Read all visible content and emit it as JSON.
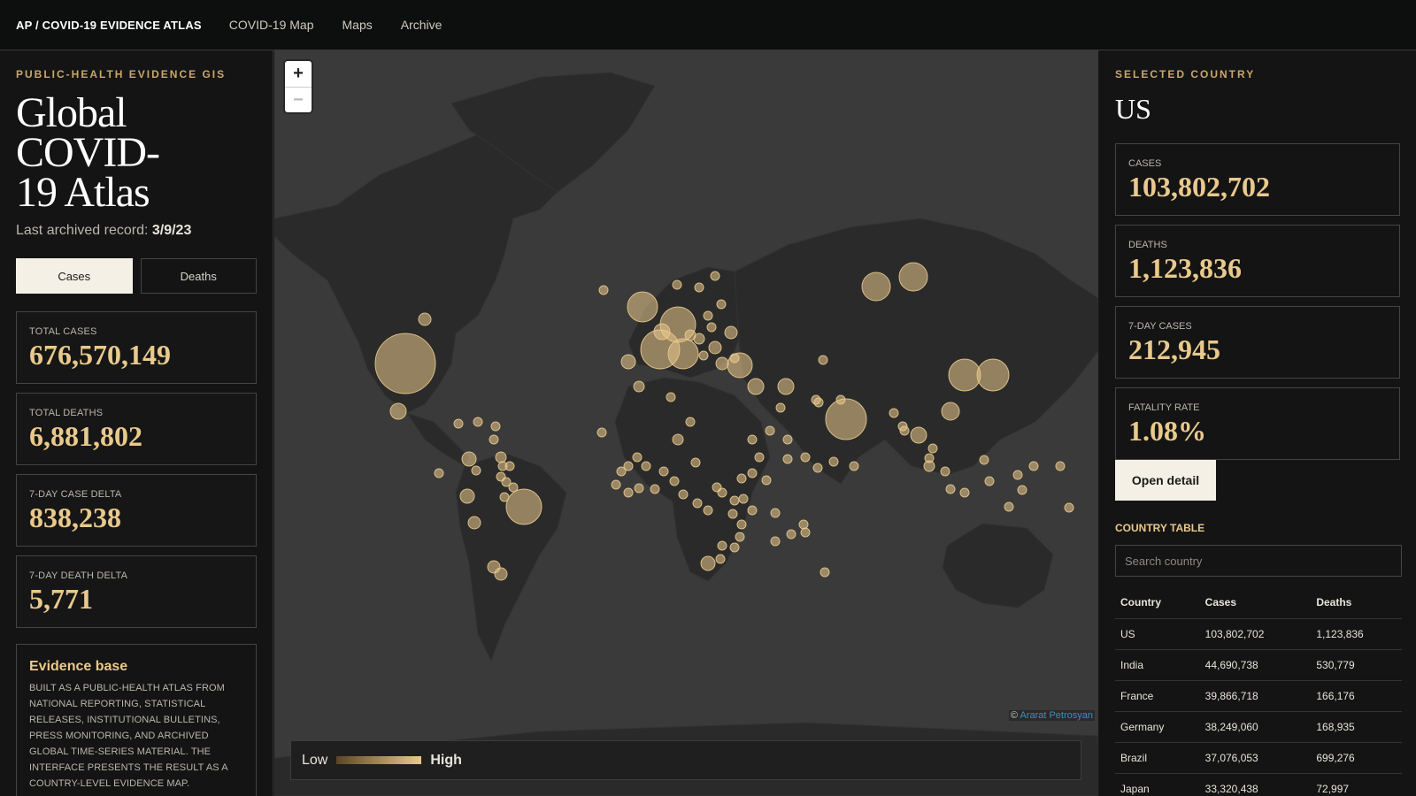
{
  "nav": {
    "brand": "AP / COVID-19 EVIDENCE ATLAS",
    "links": [
      "COVID-19 Map",
      "Maps",
      "Archive"
    ]
  },
  "left": {
    "eyebrow": "PUBLIC-HEALTH EVIDENCE GIS",
    "title": "Global COVID-19 Atlas",
    "subtitle_prefix": "Last archived record:",
    "subtitle_date": "3/9/23",
    "toggle": {
      "cases": "Cases",
      "deaths": "Deaths",
      "selected": "cases"
    },
    "stats": [
      {
        "label": "TOTAL CASES",
        "value": "676,570,149"
      },
      {
        "label": "TOTAL DEATHS",
        "value": "6,881,802"
      },
      {
        "label": "7-DAY CASE DELTA",
        "value": "838,238"
      },
      {
        "label": "7-DAY DEATH DELTA",
        "value": "5,771"
      }
    ],
    "evidence": {
      "title": "Evidence base",
      "text": "Built as a public-health atlas from national reporting, statistical releases, institutional bulletins, press monitoring, and archived global time-series material. The interface presents the result as a country-level evidence map."
    }
  },
  "map": {
    "zoom_in": "+",
    "zoom_out": "−",
    "attribution_prefix": "©",
    "attribution_link": "Ararat Petrosyan",
    "legend_low": "Low",
    "legend_high": "High",
    "colors": {
      "bubble": "#e9c98c",
      "land": "#2a2a2a",
      "water": "#3a3a3a"
    }
  },
  "right": {
    "eyebrow": "SELECTED COUNTRY",
    "country": "US",
    "stats": [
      {
        "label": "CASES",
        "value": "103,802,702"
      },
      {
        "label": "DEATHS",
        "value": "1,123,836"
      },
      {
        "label": "7-DAY CASES",
        "value": "212,945"
      },
      {
        "label": "FATALITY RATE",
        "value": "1.08%"
      }
    ],
    "open_button": "Open detail",
    "table_heading": "COUNTRY TABLE",
    "search_placeholder": "Search country",
    "columns": [
      "Country",
      "Cases",
      "Deaths"
    ],
    "rows": [
      [
        "US",
        "103,802,702",
        "1,123,836"
      ],
      [
        "India",
        "44,690,738",
        "530,779"
      ],
      [
        "France",
        "39,866,718",
        "166,176"
      ],
      [
        "Germany",
        "38,249,060",
        "168,935"
      ],
      [
        "Brazil",
        "37,076,053",
        "699,276"
      ],
      [
        "Japan",
        "33,320,438",
        "72,997"
      ]
    ]
  }
}
